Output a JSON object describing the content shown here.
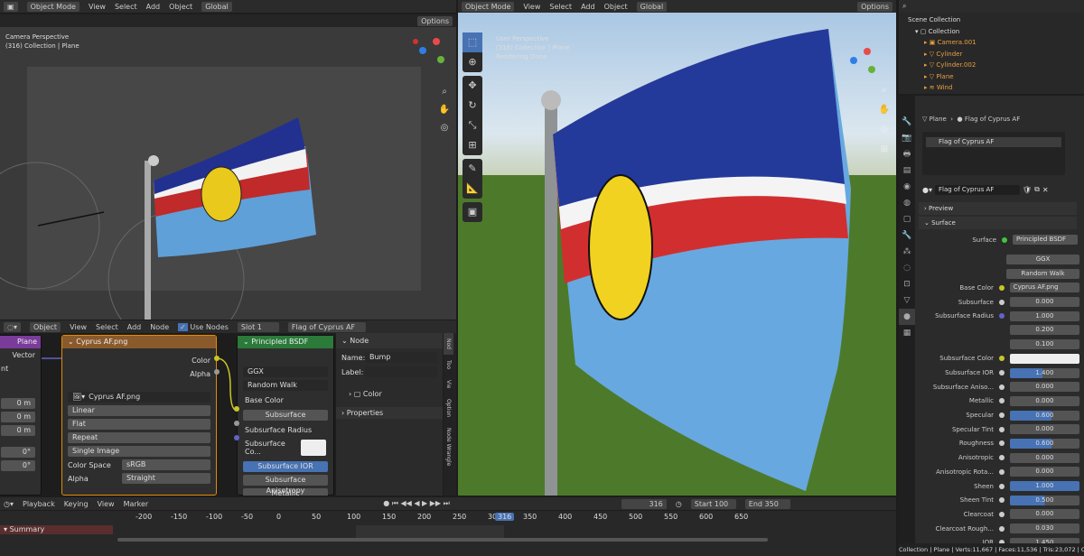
{
  "vp1": {
    "mode": "Object Mode",
    "menus": [
      "View",
      "Select",
      "Add",
      "Object"
    ],
    "transform": "Global",
    "options": "Options",
    "persp": "Camera Perspective",
    "coll": "(316) Collection | Plane"
  },
  "vp2": {
    "mode": "Object Mode",
    "menus": [
      "View",
      "Select",
      "Add",
      "Object"
    ],
    "transform": "Global",
    "options": "Options",
    "persp": "User Perspective",
    "coll": "(316) Collection | Plane",
    "status": "Rendering Done"
  },
  "outliner": {
    "root": "Scene Collection",
    "coll": "Collection",
    "items": [
      "Camera.001",
      "Cylinder",
      "Cylinder.002",
      "Plane",
      "Wind"
    ]
  },
  "props": {
    "obj": "Plane",
    "mat": "Flag of Cyprus AF",
    "slot": "Flag of Cyprus AF",
    "matname": "Flag of Cyprus AF",
    "preview": "Preview",
    "surface_h": "Surface",
    "surface_lbl": "Surface",
    "surface": "Principled BSDF",
    "dist": "GGX",
    "sss": "Random Walk",
    "basecolor_lbl": "Base Color",
    "basecolor": "Cyprus AF.png",
    "rows": [
      [
        "Subsurface",
        "0.000"
      ],
      [
        "Subsurface Radius",
        "1.000"
      ],
      [
        "",
        "0.200"
      ],
      [
        "",
        "0.100"
      ],
      [
        "Subsurface Color",
        ""
      ],
      [
        "Subsurface IOR",
        "1.400"
      ],
      [
        "Subsurface Aniso...",
        "0.000"
      ],
      [
        "Metallic",
        "0.000"
      ],
      [
        "Specular",
        "0.600"
      ],
      [
        "Specular Tint",
        "0.000"
      ],
      [
        "Roughness",
        "0.600"
      ],
      [
        "Anisotropic",
        "0.000"
      ],
      [
        "Anisotropic Rota...",
        "0.000"
      ],
      [
        "Sheen",
        "1.000"
      ],
      [
        "Sheen Tint",
        "0.500"
      ],
      [
        "Clearcoat",
        "0.000"
      ],
      [
        "Clearcoat Rough...",
        "0.030"
      ],
      [
        "IOR",
        "1.450"
      ]
    ]
  },
  "nodeed": {
    "editor": "Object",
    "menus": [
      "View",
      "Select",
      "Add",
      "Node"
    ],
    "usenodes": "Use Nodes",
    "slot": "Slot 1",
    "mat": "Flag of Cyprus AF",
    "plane": "Plane",
    "vector": "Vector",
    "tex": "Cyprus AF.png",
    "texout": [
      "Color",
      "Alpha"
    ],
    "img": "Cyprus AF.png",
    "tex_opts": [
      "Linear",
      "Flat",
      "Repeat",
      "Single Image"
    ],
    "cs_lbl": "Color Space",
    "cs": "sRGB",
    "al_lbl": "Alpha",
    "al": "Straight",
    "leftvals": [
      "0 m",
      "0 m",
      "0 m",
      "0°",
      "0°"
    ],
    "leftlbl": "nt",
    "bsdf": "Principled BSDF",
    "bsdf_rows": [
      "GGX",
      "Random Walk",
      "Base Color",
      "Subsurface",
      "Subsurface Radius",
      "Subsurface Co...",
      "Subsurface IOR",
      "Subsurface Anisotropy",
      "Metallic"
    ],
    "panel_h": "Node",
    "name_lbl": "Name:",
    "name": "Bump",
    "label_lbl": "Label:",
    "color": "Color",
    "properties": "Properties",
    "tabs": [
      "Nod",
      "Too",
      "Vie",
      "Option",
      "Node Wrangle"
    ]
  },
  "timeline": {
    "menus": [
      "Playback",
      "Keying",
      "View",
      "Marker"
    ],
    "frame": "316",
    "start_lbl": "Start",
    "start": "100",
    "end_lbl": "End",
    "end": "350",
    "ticks": [
      "-200",
      "-150",
      "-100",
      "-50",
      "0",
      "50",
      "100",
      "150",
      "200",
      "250",
      "300",
      "350",
      "400",
      "450",
      "500",
      "550",
      "600",
      "650"
    ],
    "summary": "Summary"
  },
  "status": "Collection | Plane | Verts:11,667 | Faces:11,536 | Tris:23,072 | Objects:0/6 | 3.4.1"
}
